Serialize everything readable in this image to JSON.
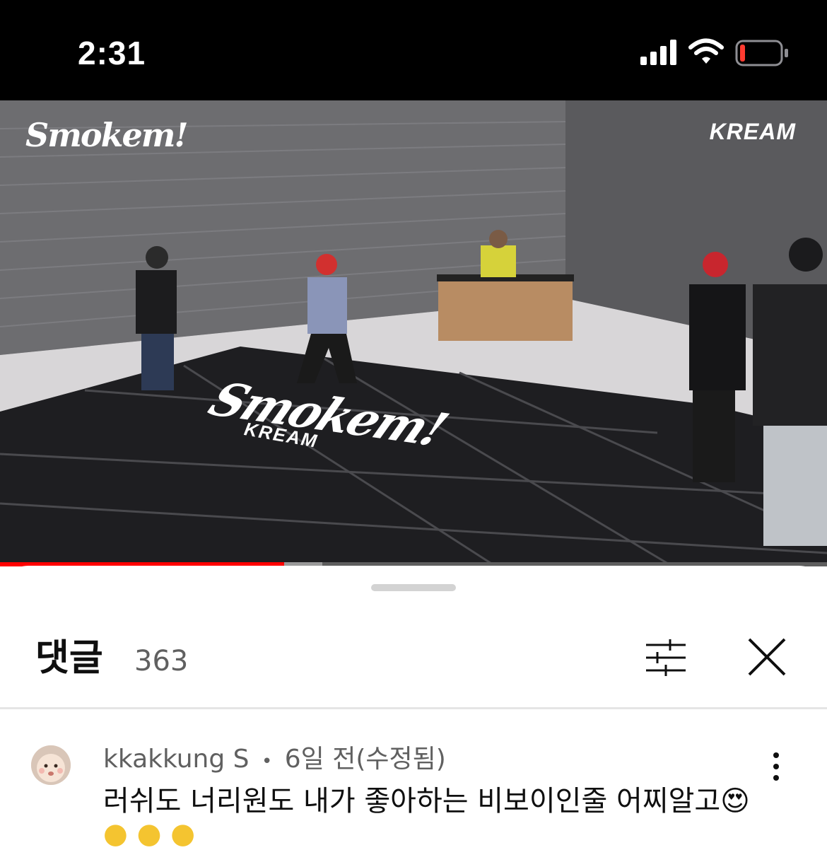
{
  "status_bar": {
    "time": "2:31",
    "battery_color": "#ff3b30"
  },
  "video": {
    "logo_left": "Smokem!",
    "logo_right": "KREAM",
    "floor_logo": "Smokem!",
    "floor_sub": "KREAM",
    "played_fraction": 0.344,
    "buffered_fraction": 0.39,
    "progress_color": "#ff0000"
  },
  "comments_panel": {
    "title": "댓글",
    "count": "363",
    "filter_icon": "sliders-icon",
    "close_icon": "close-icon"
  },
  "comment": {
    "author": "kkakkung S",
    "separator": "•",
    "time": "6일 전(수정됨)",
    "text": "러쉬도 너리원도 내가 좋아하는 비보이인줄 어찌알고😍",
    "more_icon": "more-vertical-icon"
  }
}
